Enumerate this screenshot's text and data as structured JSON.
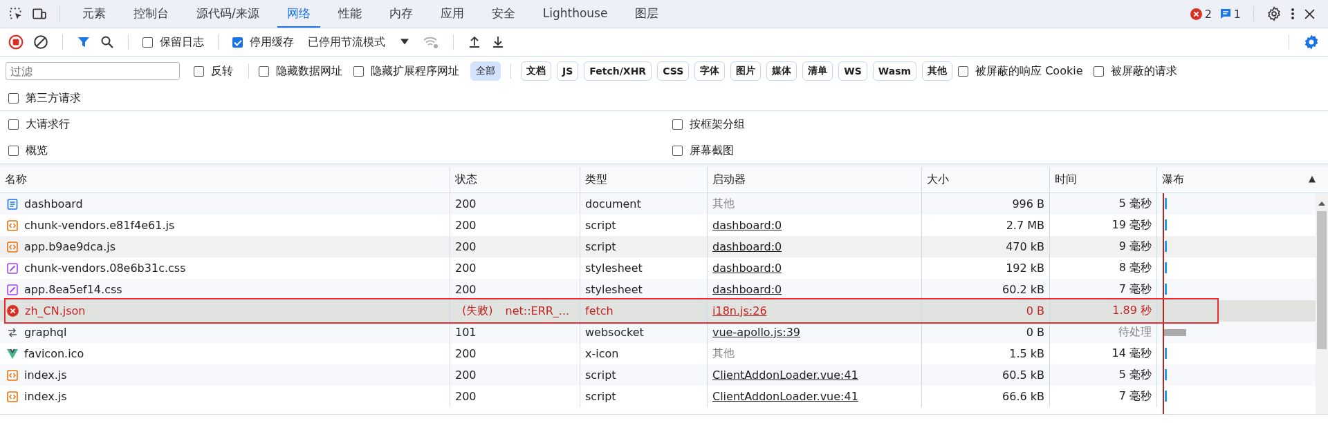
{
  "tabs": [
    {
      "label": "元素",
      "selected": false
    },
    {
      "label": "控制台",
      "selected": false
    },
    {
      "label": "源代码/来源",
      "selected": false
    },
    {
      "label": "网络",
      "selected": true
    },
    {
      "label": "性能",
      "selected": false
    },
    {
      "label": "内存",
      "selected": false
    },
    {
      "label": "应用",
      "selected": false
    },
    {
      "label": "安全",
      "selected": false
    },
    {
      "label": "Lighthouse",
      "selected": false
    },
    {
      "label": "图层",
      "selected": false
    }
  ],
  "errors_count": "2",
  "messages_count": "1",
  "toolbar": {
    "preserve_log": {
      "label": "保留日志",
      "checked": false
    },
    "disable_cache": {
      "label": "停用缓存",
      "checked": true
    },
    "throttling": "已停用节流模式"
  },
  "filter": {
    "placeholder": "过滤",
    "checks": [
      {
        "label": "反转",
        "checked": false
      },
      {
        "label": "隐藏数据网址",
        "checked": false
      },
      {
        "label": "隐藏扩展程序网址",
        "checked": false
      }
    ],
    "types": [
      {
        "label": "全部",
        "selected": true
      },
      {
        "label": "文档",
        "selected": false
      },
      {
        "label": "JS",
        "selected": false
      },
      {
        "label": "Fetch/XHR",
        "selected": false
      },
      {
        "label": "CSS",
        "selected": false
      },
      {
        "label": "字体",
        "selected": false
      },
      {
        "label": "图片",
        "selected": false
      },
      {
        "label": "媒体",
        "selected": false
      },
      {
        "label": "清单",
        "selected": false
      },
      {
        "label": "WS",
        "selected": false
      },
      {
        "label": "Wasm",
        "selected": false
      },
      {
        "label": "其他",
        "selected": false
      }
    ],
    "more_checks": [
      {
        "label": "被屏蔽的响应 Cookie",
        "checked": false
      },
      {
        "label": "被屏蔽的请求",
        "checked": false
      },
      {
        "label": "第三方请求",
        "checked": false
      }
    ]
  },
  "options": [
    {
      "label": "大请求行",
      "checked": false
    },
    {
      "label": "按框架分组",
      "checked": false
    },
    {
      "label": "概览",
      "checked": false
    },
    {
      "label": "屏幕截图",
      "checked": false
    }
  ],
  "table": {
    "columns": [
      "名称",
      "状态",
      "类型",
      "启动器",
      "大小",
      "时间",
      "瀑布"
    ],
    "sort_indicator": "▲",
    "rows": [
      {
        "kind": "document",
        "name": "dashboard",
        "status": "200",
        "type": "document",
        "initiator": "其他",
        "initiator_link": false,
        "size": "996 B",
        "time": "5 毫秒",
        "time_pending": false,
        "failed": false,
        "hovered": false,
        "annotated": false,
        "waterfall_bar": true
      },
      {
        "kind": "script",
        "name": "chunk-vendors.e81f4e61.js",
        "status": "200",
        "type": "script",
        "initiator": "dashboard:0",
        "initiator_link": true,
        "size": "2.7 MB",
        "time": "19 毫秒",
        "time_pending": false,
        "failed": false,
        "hovered": false,
        "annotated": false,
        "waterfall_bar": true
      },
      {
        "kind": "script",
        "name": "app.b9ae9dca.js",
        "status": "200",
        "type": "script",
        "initiator": "dashboard:0",
        "initiator_link": true,
        "size": "470 kB",
        "time": "9 毫秒",
        "time_pending": false,
        "failed": false,
        "hovered": true,
        "annotated": false,
        "waterfall_bar": true
      },
      {
        "kind": "stylesheet",
        "name": "chunk-vendors.08e6b31c.css",
        "status": "200",
        "type": "stylesheet",
        "initiator": "dashboard:0",
        "initiator_link": true,
        "size": "192 kB",
        "time": "8 毫秒",
        "time_pending": false,
        "failed": false,
        "hovered": false,
        "annotated": false,
        "waterfall_bar": true
      },
      {
        "kind": "stylesheet",
        "name": "app.8ea5ef14.css",
        "status": "200",
        "type": "stylesheet",
        "initiator": "dashboard:0",
        "initiator_link": true,
        "size": "60.2 kB",
        "time": "7 毫秒",
        "time_pending": false,
        "failed": false,
        "hovered": false,
        "annotated": false,
        "waterfall_bar": true
      },
      {
        "kind": "error",
        "name": "zh_CN.json",
        "status": "(失败)",
        "status_detail": "net::ERR_...",
        "type": "fetch",
        "initiator": "i18n.js:26",
        "initiator_link": true,
        "size": "0 B",
        "time": "1.89 秒",
        "time_pending": false,
        "failed": true,
        "hovered": false,
        "annotated": true,
        "waterfall_bar": false
      },
      {
        "kind": "websocket",
        "name": "graphql",
        "status": "101",
        "type": "websocket",
        "initiator": "vue-apollo.js:39",
        "initiator_link": true,
        "size": "0 B",
        "time": "待处理",
        "time_pending": true,
        "failed": false,
        "hovered": false,
        "annotated": false,
        "waterfall_bar": false
      },
      {
        "kind": "vue",
        "name": "favicon.ico",
        "status": "200",
        "type": "x-icon",
        "initiator": "其他",
        "initiator_link": false,
        "size": "1.5 kB",
        "time": "14 毫秒",
        "time_pending": false,
        "failed": false,
        "hovered": false,
        "annotated": false,
        "waterfall_bar": true
      },
      {
        "kind": "script",
        "name": "index.js",
        "status": "200",
        "type": "script",
        "initiator": "ClientAddonLoader.vue:41",
        "initiator_link": true,
        "size": "60.5 kB",
        "time": "5 毫秒",
        "time_pending": false,
        "failed": false,
        "hovered": false,
        "annotated": false,
        "waterfall_bar": true
      },
      {
        "kind": "script",
        "name": "index.js",
        "status": "200",
        "type": "script",
        "initiator": "ClientAddonLoader.vue:41",
        "initiator_link": true,
        "size": "66.6 kB",
        "time": "7 毫秒",
        "time_pending": false,
        "failed": false,
        "hovered": false,
        "annotated": false,
        "waterfall_bar": true
      }
    ]
  }
}
